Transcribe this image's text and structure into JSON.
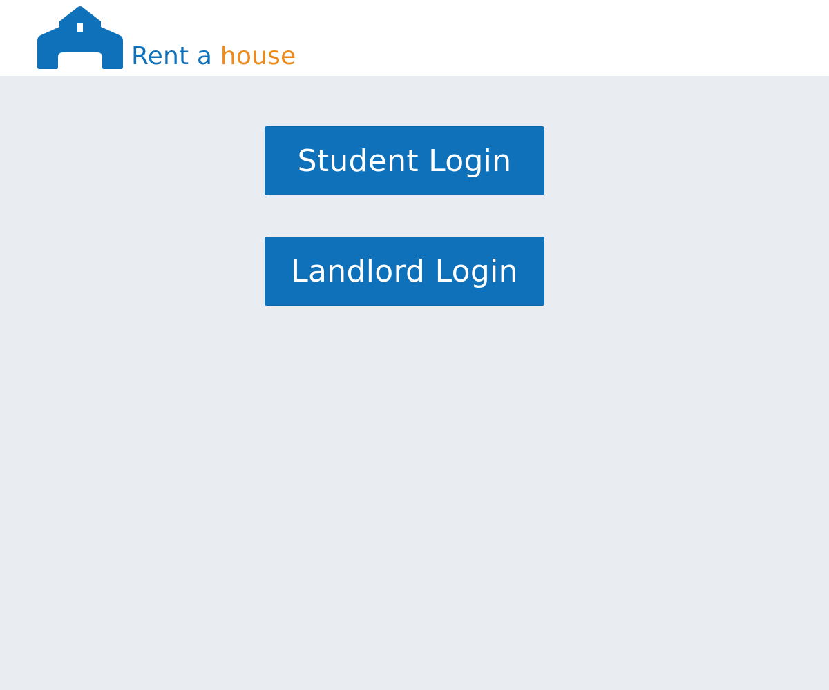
{
  "header": {
    "logo": {
      "icon": "house-icon",
      "text_part1": "Rent a",
      "text_part2": "house"
    }
  },
  "main": {
    "student_login_label": "Student Login",
    "landlord_login_label": "Landlord Login"
  },
  "colors": {
    "brand_blue": "#0e71b9",
    "brand_orange": "#ec8a1c",
    "page_background": "#e9ecf1",
    "header_background": "#ffffff",
    "button_text": "#ffffff"
  }
}
